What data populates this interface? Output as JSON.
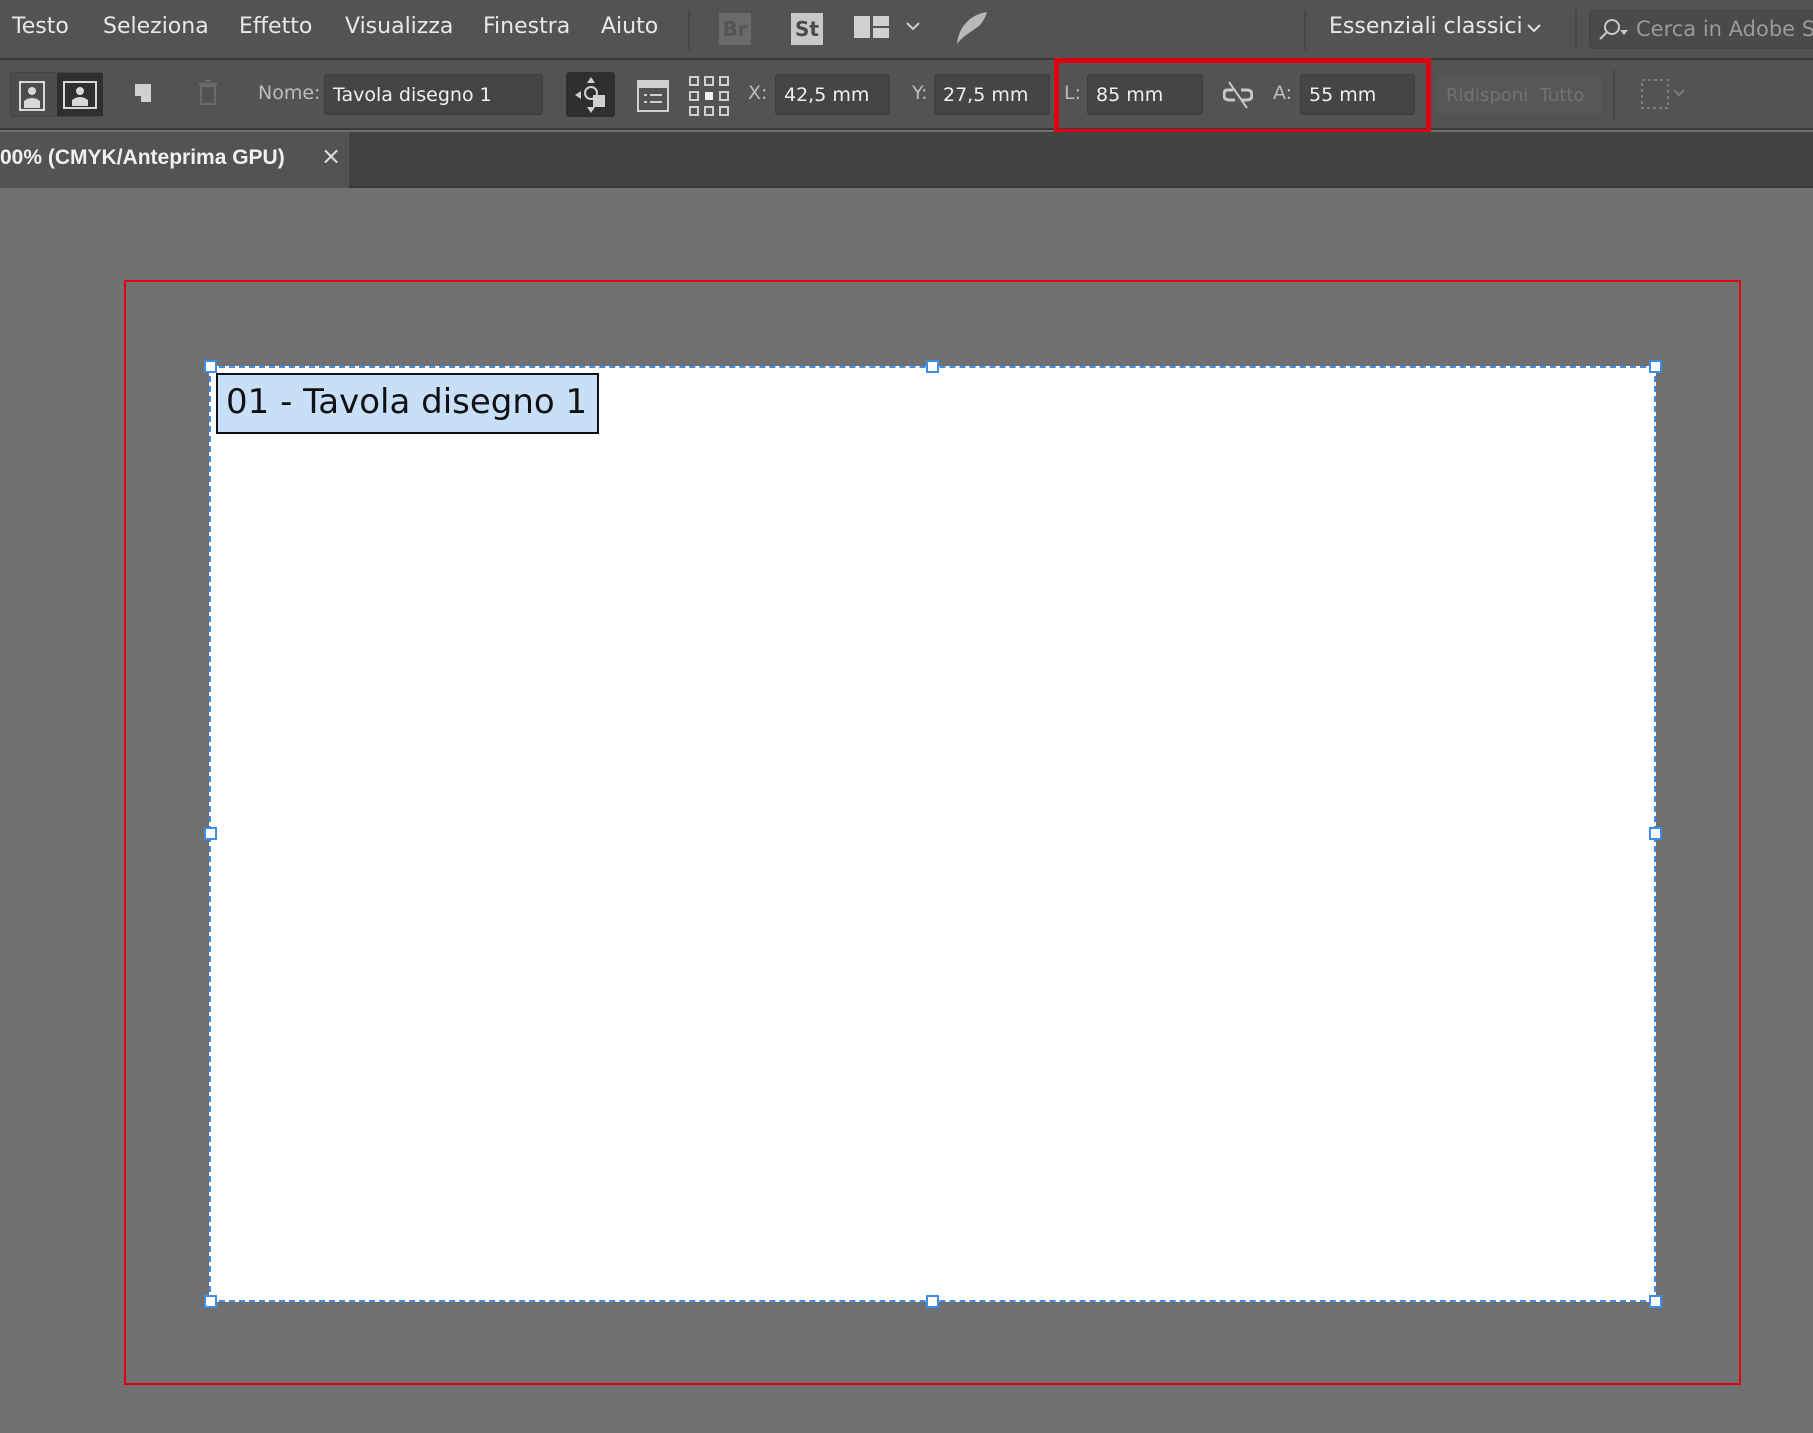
{
  "menubar": {
    "items": [
      "Testo",
      "Seleziona",
      "Effetto",
      "Visualizza",
      "Finestra",
      "Aiuto"
    ],
    "bridge": "Br",
    "stock": "St",
    "workspace": "Essenziali classici",
    "search_placeholder": "Cerca in Adobe Stock"
  },
  "toolbar": {
    "name_label": "Nome:",
    "name_value": "Tavola disegno 1",
    "x_label": "X:",
    "x_value": "42,5 mm",
    "y_label": "Y:",
    "y_value": "27,5 mm",
    "w_label": "L:",
    "w_value": "85 mm",
    "h_label": "A:",
    "h_value": "55 mm",
    "rearrange": "Ridisponi  Tutto"
  },
  "tab": {
    "title": "00% (CMYK/Anteprima GPU)",
    "close": "×"
  },
  "artboard": {
    "label": "01 - Tavola disegno 1"
  },
  "colors": {
    "highlight": "#e0000f",
    "selection": "#3d8ee8",
    "label_bg": "#c7e0f8"
  }
}
